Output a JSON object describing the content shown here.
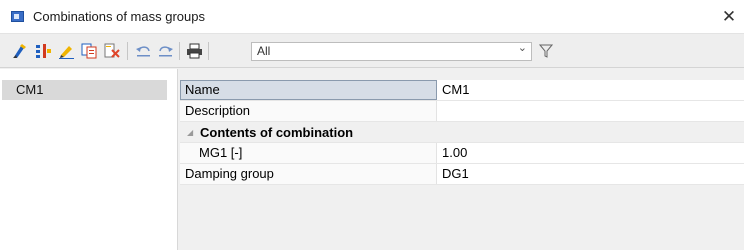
{
  "window": {
    "title": "Combinations of mass groups",
    "close_glyph": "✕"
  },
  "toolbar": {
    "buttons": [
      {
        "icon": "new-icon"
      },
      {
        "icon": "insert-icon"
      },
      {
        "icon": "edit-icon"
      },
      {
        "icon": "copy-icon"
      },
      {
        "icon": "delete-icon"
      },
      {
        "icon": "undo-icon"
      },
      {
        "icon": "redo-icon"
      },
      {
        "icon": "print-icon"
      }
    ],
    "filter_value": "All",
    "filter_arrow": "⌄"
  },
  "list": {
    "items": [
      {
        "label": "CM1",
        "selected": true
      }
    ]
  },
  "properties": {
    "name_label": "Name",
    "name_value": "CM1",
    "description_label": "Description",
    "description_value": "",
    "section_label": "Contents of combination",
    "section_glyph": "◢",
    "mg1_label": "MG1 [-]",
    "mg1_value": "1.00",
    "damping_label": "Damping group",
    "damping_value": "DG1"
  },
  "colors": {
    "selection": "#d9d9d9",
    "toolbar_bg": "#eeeeee",
    "title_icon": "#3a6ec7"
  }
}
